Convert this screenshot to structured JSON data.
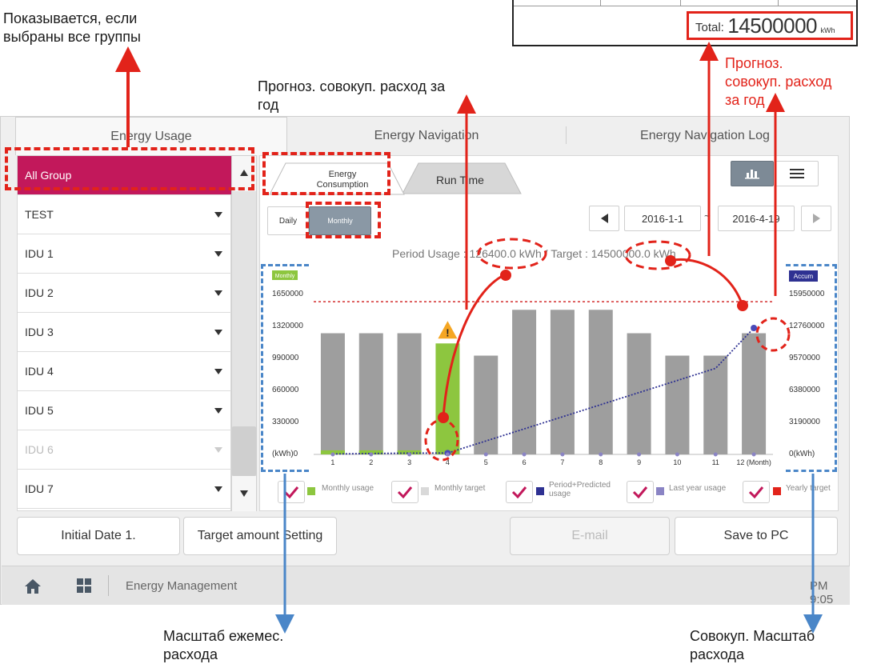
{
  "annotations": {
    "all_groups": [
      "Показывается, если",
      "выбраны все группы"
    ],
    "yearly_forecast": [
      "Прогноз. совокуп. расход за",
      "год"
    ],
    "yearly_forecast_red": [
      "Прогноз.",
      "совокуп. расход",
      "за год"
    ],
    "monthly_scale": [
      "Масштаб ежемес.",
      "расхода"
    ],
    "accum_scale": [
      "Совокуп. Масштаб",
      "расхода"
    ]
  },
  "total": {
    "label": "Total:",
    "value": "14500000",
    "unit": "kWh"
  },
  "main_tabs": [
    "Energy Usage",
    "Energy Navigation",
    "Energy Navigation Log"
  ],
  "sidebar": {
    "items": [
      {
        "label": "All Group",
        "selected": true,
        "dim": false
      },
      {
        "label": "TEST",
        "selected": false,
        "dim": false
      },
      {
        "label": "IDU 1",
        "selected": false,
        "dim": false
      },
      {
        "label": "IDU 2",
        "selected": false,
        "dim": false
      },
      {
        "label": "IDU 3",
        "selected": false,
        "dim": false
      },
      {
        "label": "IDU 4",
        "selected": false,
        "dim": false
      },
      {
        "label": "IDU 5",
        "selected": false,
        "dim": false
      },
      {
        "label": "IDU 6",
        "selected": false,
        "dim": true
      },
      {
        "label": "IDU 7",
        "selected": false,
        "dim": false
      }
    ]
  },
  "sub_tabs": {
    "energy": [
      "Energy",
      "Consumption"
    ],
    "runtime": "Run Time"
  },
  "period_buttons": {
    "daily": "Daily",
    "monthly": "Monthly"
  },
  "date_range": {
    "start": "2016-1-1",
    "separator": "~",
    "end": "2016-4-19"
  },
  "period_usage": "Period Usage : 126400.0 kWh / Target : 14500000.0 kWh",
  "axis": {
    "left_badge": "Monthly",
    "right_badge": "Accum"
  },
  "legend": [
    {
      "label": "Monthly usage",
      "color": "#8dc63f"
    },
    {
      "label": "Monthly target",
      "color": "#d9d9d9"
    },
    {
      "label": "Period+Predicted usage",
      "color": "#2e3192"
    },
    {
      "label": "Last year usage",
      "color": "#8a84c4"
    },
    {
      "label": "Yearly target",
      "color": "#e2231a"
    }
  ],
  "bottom_buttons": {
    "initial_date": "Initial Date 1.",
    "target_setting": "Target amount Setting",
    "email": "E-mail",
    "save_pc": "Save to PC"
  },
  "status": {
    "label": "Energy Management",
    "time": "PM 9:05"
  },
  "chart_data": {
    "type": "bar",
    "categories": [
      "1",
      "2",
      "3",
      "4",
      "5",
      "6",
      "7",
      "8",
      "9",
      "10",
      "11",
      "12 (Month)"
    ],
    "left_axis_ticks": [
      "1650000",
      "1320000",
      "990000",
      "660000",
      "330000",
      "(kWh)0"
    ],
    "right_axis_ticks": [
      "15950000",
      "12760000",
      "9570000",
      "6380000",
      "3190000",
      "0(kWh)"
    ],
    "ylim": [
      0,
      1650000
    ],
    "y2lim": [
      0,
      15950000
    ],
    "series": [
      {
        "name": "Monthly target",
        "values": [
          1190000,
          1190000,
          1190000,
          0,
          970000,
          1420000,
          1420000,
          1420000,
          1190000,
          970000,
          970000,
          1190000
        ]
      },
      {
        "name": "Monthly usage",
        "values": [
          40000,
          40000,
          40000,
          1090000,
          0,
          0,
          0,
          0,
          0,
          0,
          0,
          0
        ]
      },
      {
        "name": "Period+Predicted usage",
        "values": [
          40000,
          80000,
          120000,
          126400,
          1275400,
          2424400,
          3573400,
          4722400,
          5871400,
          7020400,
          8169400,
          12000000
        ]
      },
      {
        "name": "Yearly target",
        "values": [
          14500000
        ]
      }
    ]
  }
}
